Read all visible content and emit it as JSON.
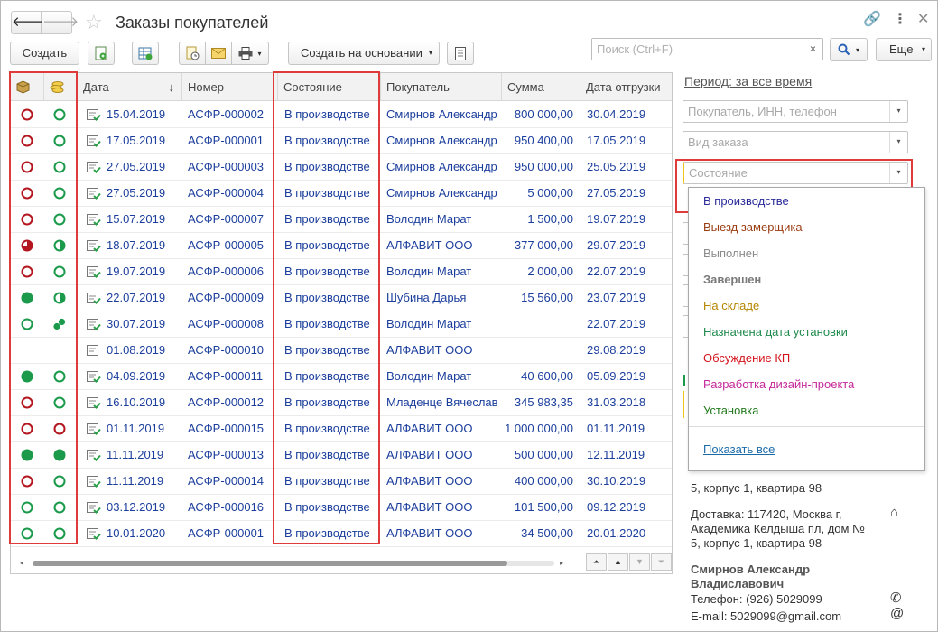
{
  "window": {
    "title": "Заказы покупателей",
    "back": "🡐",
    "forward": "🡒",
    "link_icon": "🔗",
    "menu_icon": "⋮",
    "close_icon": "✕"
  },
  "toolbar": {
    "create": "Создать",
    "create_based_on": "Создать на основании",
    "search_placeholder": "Поиск (Ctrl+F)",
    "search_clear": "×",
    "more": "Еще",
    "dropdown_arrow": "▾"
  },
  "table": {
    "headers": {
      "date": "Дата",
      "sort_arrow": "↓",
      "number": "Номер",
      "state": "Состояние",
      "buyer": "Покупатель",
      "sum": "Сумма",
      "ship_date": "Дата отгрузки"
    },
    "rows": [
      {
        "icon1": "red",
        "icon2": "green",
        "date": "15.04.2019",
        "number": "АСФР-000002",
        "state": "В производстве",
        "buyer": "Смирнов Александр",
        "sum": "800 000,00",
        "ship": "30.04.2019"
      },
      {
        "icon1": "red",
        "icon2": "green",
        "date": "17.05.2019",
        "number": "АСФР-000001",
        "state": "В производстве",
        "buyer": "Смирнов Александр",
        "sum": "950 400,00",
        "ship": "17.05.2019"
      },
      {
        "icon1": "red",
        "icon2": "green",
        "date": "27.05.2019",
        "number": "АСФР-000003",
        "state": "В производстве",
        "buyer": "Смирнов Александр",
        "sum": "950 000,00",
        "ship": "25.05.2019"
      },
      {
        "icon1": "red",
        "icon2": "green",
        "date": "27.05.2019",
        "number": "АСФР-000004",
        "state": "В производстве",
        "buyer": "Смирнов Александр",
        "sum": "5 000,00",
        "ship": "27.05.2019"
      },
      {
        "icon1": "red",
        "icon2": "green",
        "date": "15.07.2019",
        "number": "АСФР-000007",
        "state": "В производстве",
        "buyer": "Володин Марат",
        "sum": "1 500,00",
        "ship": "19.07.2019"
      },
      {
        "icon1": "red-partial",
        "icon2": "green-partial",
        "date": "18.07.2019",
        "number": "АСФР-000005",
        "state": "В производстве",
        "buyer": "АЛФАВИТ ООО",
        "sum": "377 000,00",
        "ship": "29.07.2019"
      },
      {
        "icon1": "red",
        "icon2": "green",
        "date": "19.07.2019",
        "number": "АСФР-000006",
        "state": "В производстве",
        "buyer": "Володин Марат",
        "sum": "2 000,00",
        "ship": "22.07.2019"
      },
      {
        "icon1": "green-filled",
        "icon2": "green-partial",
        "date": "22.07.2019",
        "number": "АСФР-000009",
        "state": "В производстве",
        "buyer": "Шубина Дарья",
        "sum": "15 560,00",
        "ship": "23.07.2019"
      },
      {
        "icon1": "green",
        "icon2": "green-multi",
        "date": "30.07.2019",
        "number": "АСФР-000008",
        "state": "В производстве",
        "buyer": "Володин Марат",
        "sum": "",
        "ship": "22.07.2019"
      },
      {
        "icon1": "none",
        "icon2": "none",
        "date": "01.08.2019",
        "number": "АСФР-000010",
        "state": "В производстве",
        "buyer": "АЛФАВИТ ООО",
        "sum": "",
        "ship": "29.08.2019"
      },
      {
        "icon1": "green-filled",
        "icon2": "green",
        "date": "04.09.2019",
        "number": "АСФР-000011",
        "state": "В производстве",
        "buyer": "Володин Марат",
        "sum": "40 600,00",
        "ship": "05.09.2019"
      },
      {
        "icon1": "red",
        "icon2": "green",
        "date": "16.10.2019",
        "number": "АСФР-000012",
        "state": "В производстве",
        "buyer": "Младенце Вячеслав",
        "sum": "345 983,35",
        "ship": "31.03.2018"
      },
      {
        "icon1": "red",
        "icon2": "red",
        "date": "01.11.2019",
        "number": "АСФР-000015",
        "state": "В производстве",
        "buyer": "АЛФАВИТ ООО",
        "sum": "1 000 000,00",
        "ship": "01.11.2019"
      },
      {
        "icon1": "green-filled",
        "icon2": "green-filled",
        "date": "11.11.2019",
        "number": "АСФР-000013",
        "state": "В производстве",
        "buyer": "АЛФАВИТ ООО",
        "sum": "500 000,00",
        "ship": "12.11.2019"
      },
      {
        "icon1": "red",
        "icon2": "green",
        "date": "11.11.2019",
        "number": "АСФР-000014",
        "state": "В производстве",
        "buyer": "АЛФАВИТ ООО",
        "sum": "400 000,00",
        "ship": "30.10.2019"
      },
      {
        "icon1": "green",
        "icon2": "green",
        "date": "03.12.2019",
        "number": "АСФР-000016",
        "state": "В производстве",
        "buyer": "АЛФАВИТ ООО",
        "sum": "101 500,00",
        "ship": "09.12.2019"
      },
      {
        "icon1": "green",
        "icon2": "green",
        "date": "10.01.2020",
        "number": "АСФР-000001",
        "state": "В производстве",
        "buyer": "АЛФАВИТ ООО",
        "sum": "34 500,00",
        "ship": "20.01.2020"
      }
    ]
  },
  "filters": {
    "period": "Период: за все время",
    "buyer_placeholder": "Покупатель, ИНН, телефон",
    "order_type_placeholder": "Вид заказа",
    "state_placeholder": "Состояние"
  },
  "state_dropdown": {
    "items": [
      {
        "label": "В производстве",
        "color": "#2a2a9a"
      },
      {
        "label": "Выезд замерщика",
        "color": "#9a3d12"
      },
      {
        "label": "Выполнен",
        "color": "#8a8a8a"
      },
      {
        "label": "Завершен",
        "color": "#7a7a7a",
        "bold": true
      },
      {
        "label": "На складе",
        "color": "#b58600"
      },
      {
        "label": "Назначена дата установки",
        "color": "#1f8a4c"
      },
      {
        "label": "Обсуждение КП",
        "color": "#d4141c"
      },
      {
        "label": "Разработка дизайн-проекта",
        "color": "#c4289a"
      },
      {
        "label": "Установка",
        "color": "#247a1e"
      }
    ],
    "show_all": "Показать все"
  },
  "customer_info": {
    "address_tail": "5, корпус 1, квартира 98",
    "delivery_line1": "Доставка: 117420, Москва г,",
    "delivery_line2": "Академика Келдыша пл, дом №",
    "delivery_line3": "5, корпус 1, квартира 98",
    "name_line1": "Смирнов Александр",
    "name_line2": "Владиславович",
    "phone": "Телефон: (926) 5029099",
    "email": "E-mail: 5029099@gmail.com",
    "home_icon": "⌂",
    "phone_icon": "✆",
    "email_icon": "@"
  },
  "colors": {
    "highlight_red": "#e03b3b",
    "link_blue": "#1b3e9c",
    "status_red": "#b3161e",
    "status_green": "#1a9a4a"
  }
}
